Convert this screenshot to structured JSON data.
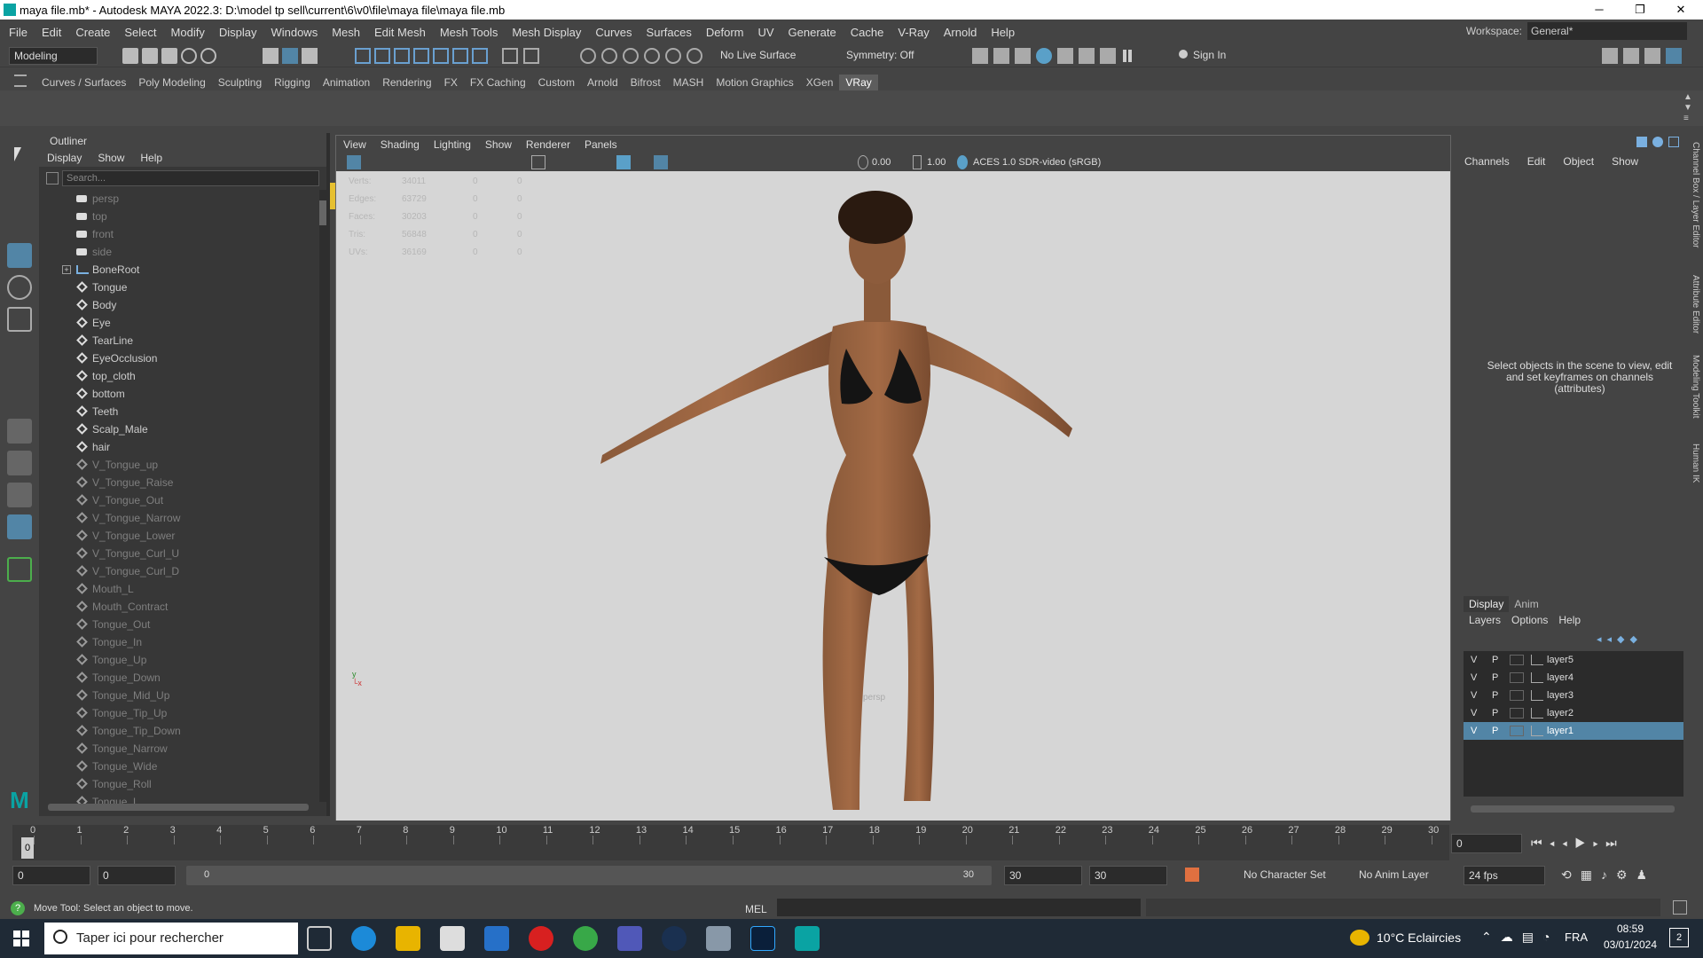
{
  "window": {
    "title": "maya file.mb* - Autodesk MAYA 2022.3: D:\\model tp sell\\current\\6\\v0\\file\\maya file\\maya file.mb",
    "minimize": "─",
    "maximize": "❐",
    "close": "✕"
  },
  "menubar": {
    "items": [
      "File",
      "Edit",
      "Create",
      "Select",
      "Modify",
      "Display",
      "Windows",
      "Mesh",
      "Edit Mesh",
      "Mesh Tools",
      "Mesh Display",
      "Curves",
      "Surfaces",
      "Deform",
      "UV",
      "Generate",
      "Cache",
      "V-Ray",
      "Arnold",
      "Help"
    ],
    "workspace_label": "Workspace:",
    "workspace_value": "General*"
  },
  "statusline": {
    "mode": "Modeling",
    "live_surface": "No Live Surface",
    "symmetry": "Symmetry: Off",
    "sign_in": "Sign In"
  },
  "shelf": {
    "tabs": [
      "Curves / Surfaces",
      "Poly Modeling",
      "Sculpting",
      "Rigging",
      "Animation",
      "Rendering",
      "FX",
      "FX Caching",
      "Custom",
      "Arnold",
      "Bifrost",
      "MASH",
      "Motion Graphics",
      "XGen",
      "VRay"
    ],
    "active_tab": "VRay"
  },
  "outliner": {
    "title": "Outliner",
    "menu": [
      "Display",
      "Show",
      "Help"
    ],
    "search_placeholder": "Search...",
    "items": [
      {
        "label": "persp",
        "kind": "cam",
        "dim": true
      },
      {
        "label": "top",
        "kind": "cam",
        "dim": true
      },
      {
        "label": "front",
        "kind": "cam",
        "dim": true
      },
      {
        "label": "side",
        "kind": "cam",
        "dim": true
      },
      {
        "label": "BoneRoot",
        "kind": "joint",
        "dim": false,
        "expand": "+"
      },
      {
        "label": "Tongue",
        "kind": "mesh",
        "dim": false
      },
      {
        "label": "Body",
        "kind": "mesh",
        "dim": false
      },
      {
        "label": "Eye",
        "kind": "mesh",
        "dim": false
      },
      {
        "label": "TearLine",
        "kind": "mesh",
        "dim": false
      },
      {
        "label": "EyeOcclusion",
        "kind": "mesh",
        "dim": false
      },
      {
        "label": "top_cloth",
        "kind": "mesh",
        "dim": false
      },
      {
        "label": "bottom",
        "kind": "mesh",
        "dim": false
      },
      {
        "label": "Teeth",
        "kind": "mesh",
        "dim": false
      },
      {
        "label": "Scalp_Male",
        "kind": "mesh",
        "dim": false
      },
      {
        "label": "hair",
        "kind": "mesh",
        "dim": false
      },
      {
        "label": "V_Tongue_up",
        "kind": "mesh",
        "dim": true
      },
      {
        "label": "V_Tongue_Raise",
        "kind": "mesh",
        "dim": true
      },
      {
        "label": "V_Tongue_Out",
        "kind": "mesh",
        "dim": true
      },
      {
        "label": "V_Tongue_Narrow",
        "kind": "mesh",
        "dim": true
      },
      {
        "label": "V_Tongue_Lower",
        "kind": "mesh",
        "dim": true
      },
      {
        "label": "V_Tongue_Curl_U",
        "kind": "mesh",
        "dim": true
      },
      {
        "label": "V_Tongue_Curl_D",
        "kind": "mesh",
        "dim": true
      },
      {
        "label": "Mouth_L",
        "kind": "mesh",
        "dim": true
      },
      {
        "label": "Mouth_Contract",
        "kind": "mesh",
        "dim": true
      },
      {
        "label": "Tongue_Out",
        "kind": "mesh",
        "dim": true
      },
      {
        "label": "Tongue_In",
        "kind": "mesh",
        "dim": true
      },
      {
        "label": "Tongue_Up",
        "kind": "mesh",
        "dim": true
      },
      {
        "label": "Tongue_Down",
        "kind": "mesh",
        "dim": true
      },
      {
        "label": "Tongue_Mid_Up",
        "kind": "mesh",
        "dim": true
      },
      {
        "label": "Tongue_Tip_Up",
        "kind": "mesh",
        "dim": true
      },
      {
        "label": "Tongue_Tip_Down",
        "kind": "mesh",
        "dim": true
      },
      {
        "label": "Tongue_Narrow",
        "kind": "mesh",
        "dim": true
      },
      {
        "label": "Tongue_Wide",
        "kind": "mesh",
        "dim": true
      },
      {
        "label": "Tongue_Roll",
        "kind": "mesh",
        "dim": true
      },
      {
        "label": "Tongue_L",
        "kind": "mesh",
        "dim": true
      }
    ]
  },
  "viewport": {
    "menu": [
      "View",
      "Shading",
      "Lighting",
      "Show",
      "Renderer",
      "Panels"
    ],
    "exposure": "0.00",
    "gamma": "1.00",
    "colorspace": "ACES 1.0 SDR-video (sRGB)",
    "hud": [
      {
        "label": "Verts:",
        "a": "34011",
        "b": "0",
        "c": "0"
      },
      {
        "label": "Edges:",
        "a": "63729",
        "b": "0",
        "c": "0"
      },
      {
        "label": "Faces:",
        "a": "30203",
        "b": "0",
        "c": "0"
      },
      {
        "label": "Tris:",
        "a": "56848",
        "b": "0",
        "c": "0"
      },
      {
        "label": "UVs:",
        "a": "36169",
        "b": "0",
        "c": "0"
      }
    ],
    "camera_label": "persp"
  },
  "channelbox": {
    "menu": [
      "Channels",
      "Edit",
      "Object",
      "Show"
    ],
    "message": "Select objects in the scene to view, edit and set keyframes on channels (attributes)"
  },
  "sidetabs": [
    "Channel Box / Layer Editor",
    "Attribute Editor",
    "Modeling Toolkit",
    "Human IK"
  ],
  "layers": {
    "tabs": [
      "Display",
      "Anim"
    ],
    "menu": [
      "Layers",
      "Options",
      "Help"
    ],
    "rows": [
      {
        "v": "V",
        "p": "P",
        "name": "layer5",
        "selected": false
      },
      {
        "v": "V",
        "p": "P",
        "name": "layer4",
        "selected": false
      },
      {
        "v": "V",
        "p": "P",
        "name": "layer3",
        "selected": false
      },
      {
        "v": "V",
        "p": "P",
        "name": "layer2",
        "selected": false
      },
      {
        "v": "V",
        "p": "P",
        "name": "layer1",
        "selected": true
      }
    ]
  },
  "timeline": {
    "start": 0,
    "end": 30,
    "current_frame": "0",
    "current_label": "0"
  },
  "range": {
    "start": "0",
    "playback_start": "0",
    "slider_start": "0",
    "slider_end": "30",
    "playback_end": "30",
    "end": "30",
    "character_set": "No Character Set",
    "anim_layer": "No Anim Layer",
    "fps": "24 fps"
  },
  "cmdline": {
    "help": "Move Tool: Select an object to move.",
    "lang": "MEL"
  },
  "taskbar": {
    "search": "Taper ici pour rechercher",
    "weather": "10°C  Eclaircies",
    "lang": "FRA",
    "time": "08:59",
    "date": "03/01/2024",
    "notif": "2"
  }
}
